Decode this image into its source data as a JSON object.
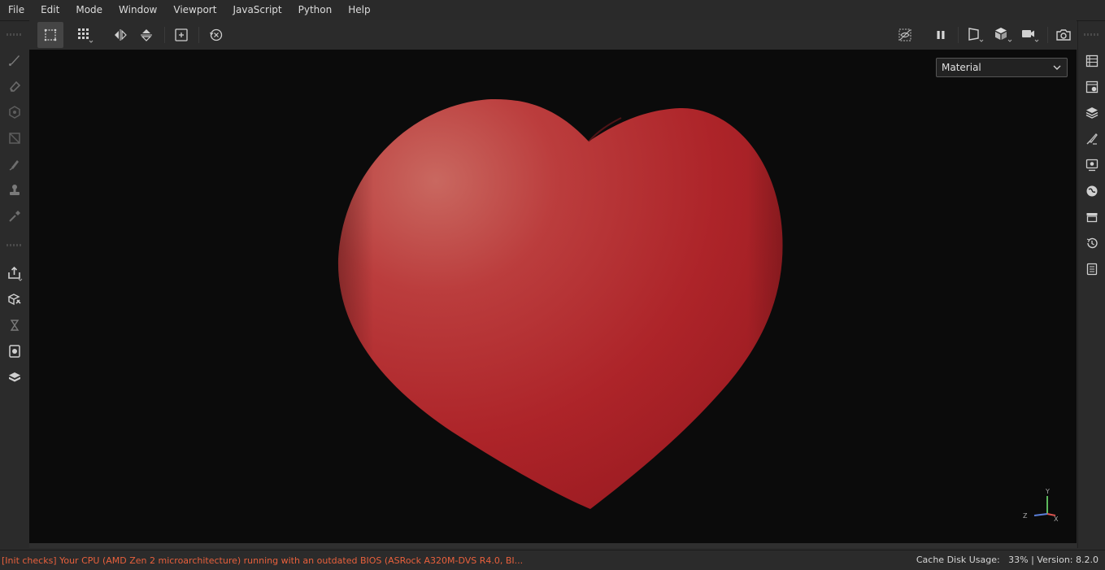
{
  "menu": {
    "items": [
      "File",
      "Edit",
      "Mode",
      "Window",
      "Viewport",
      "JavaScript",
      "Python",
      "Help"
    ]
  },
  "toolbar": {
    "left_icons": [
      "select-rectangle-icon",
      "grid-dots-icon",
      "mirror-horizontal-icon",
      "mirror-vertical-icon",
      "frame-icon",
      "reset-history-icon"
    ],
    "right_icons": [
      "hide-visibility-icon",
      "pause-icon",
      "perspective-icon",
      "cube-icon",
      "camera-video-icon",
      "screenshot-icon"
    ]
  },
  "left_tools": [
    "brush-icon",
    "eraser-icon",
    "projection-icon",
    "polyfill-icon",
    "smudge-icon",
    "clone-stamp-icon",
    "color-picker-icon",
    "export-icon",
    "bake-icon",
    "hourglass-icon",
    "iray-icon",
    "shelf-cube-icon"
  ],
  "right_panels": [
    "texture-set-list-icon",
    "texture-set-settings-icon",
    "layers-icon",
    "properties-icon",
    "display-settings-icon",
    "viewer-settings-icon",
    "shelf-icon",
    "history-icon",
    "log-icon"
  ],
  "viewport": {
    "render_mode": "Material",
    "axes": {
      "y": "Y",
      "z": "Z",
      "x": "X"
    },
    "colors": {
      "background": "#0b0b0b",
      "heart": "#b0282d",
      "axis_x": "#d9534f",
      "axis_y": "#5cb85c",
      "axis_z": "#5b7fd9"
    }
  },
  "status": {
    "message": "[Init checks] Your CPU (AMD Zen 2 microarchitecture) running with an outdated BIOS (ASRock A320M-DVS R4.0, BI...",
    "cache_label": "Cache Disk Usage:",
    "cache_value": "33%",
    "separator": "|",
    "version_label": "Version: 8.2.0"
  }
}
